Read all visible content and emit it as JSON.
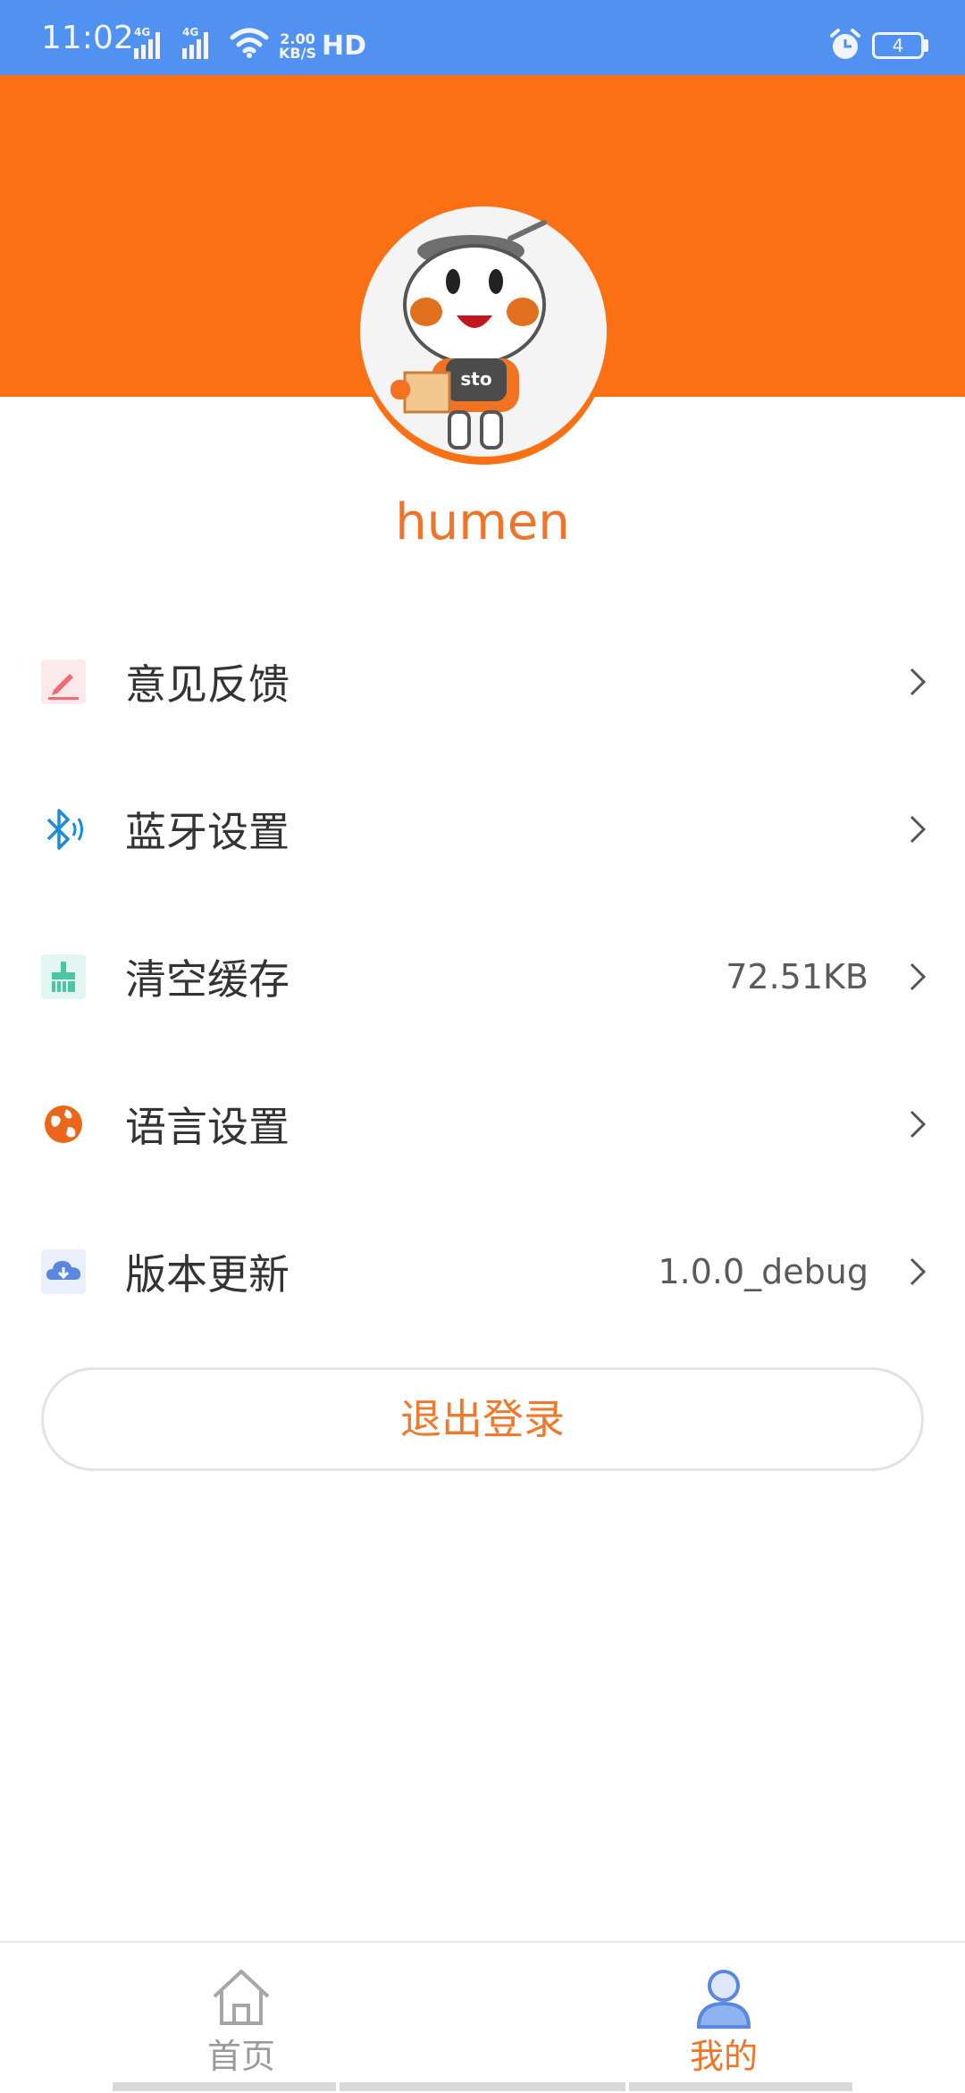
{
  "status_bar": {
    "time": "11:02",
    "net_speed_value": "2.00",
    "net_speed_unit": "KB/S",
    "hd": "HD",
    "battery": "4"
  },
  "profile": {
    "username": "humen",
    "avatar_text": "sto"
  },
  "menu": {
    "items": [
      {
        "label": "意见反馈",
        "value": "",
        "icon": "pencil-icon"
      },
      {
        "label": "蓝牙设置",
        "value": "",
        "icon": "bluetooth-icon"
      },
      {
        "label": "清空缓存",
        "value": "72.51KB",
        "icon": "brush-icon"
      },
      {
        "label": "语言设置",
        "value": "",
        "icon": "globe-icon"
      },
      {
        "label": "版本更新",
        "value": "1.0.0_debug",
        "icon": "cloud-download-icon"
      }
    ]
  },
  "logout_label": "退出登录",
  "tabs": [
    {
      "label": "首页",
      "icon": "home-icon",
      "active": false
    },
    {
      "label": "我的",
      "icon": "user-icon",
      "active": true
    }
  ],
  "colors": {
    "status_bar": "#5191f2",
    "brand_orange": "#fc7014",
    "tab_active": "#f0732a",
    "tab_inactive": "#9a9a9a"
  }
}
